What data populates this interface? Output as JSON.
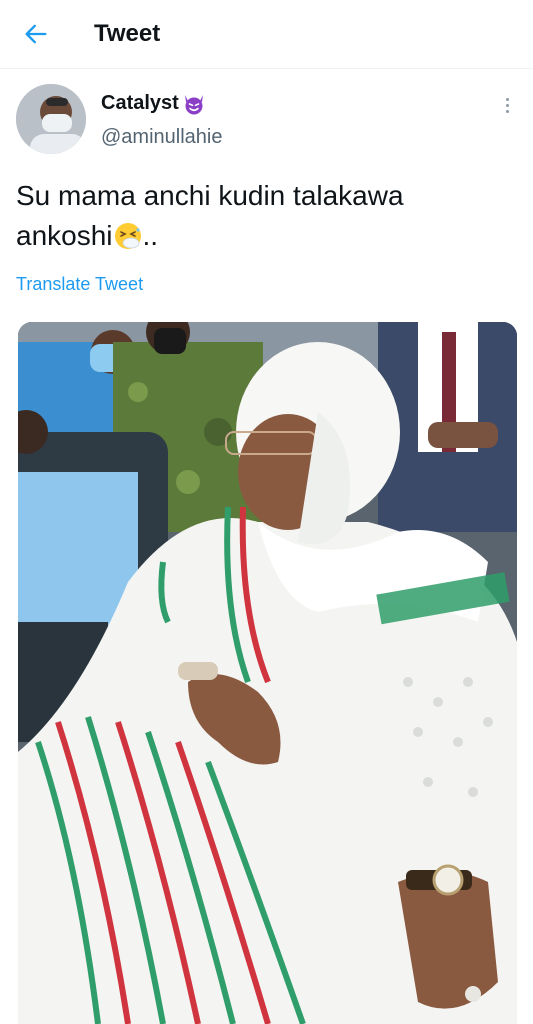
{
  "header": {
    "title": "Tweet",
    "back_icon": "arrow-left-icon",
    "accent": "#1d9bf0"
  },
  "tweet": {
    "display_name": "Catalyst",
    "name_emoji": "smiling-face-with-horns-icon",
    "handle": "@aminullahie",
    "text_line1": "Su mama anchi kudin talakawa",
    "text_line2_prefix": "ankoshi",
    "text_emoji": "sneezing-face-icon",
    "text_line2_suffix": "..",
    "translate_label": "Translate Tweet",
    "more_icon": "more-vertical-icon",
    "image_alt": "Woman in white embroidered dress with green and red stripes seated at an event"
  }
}
